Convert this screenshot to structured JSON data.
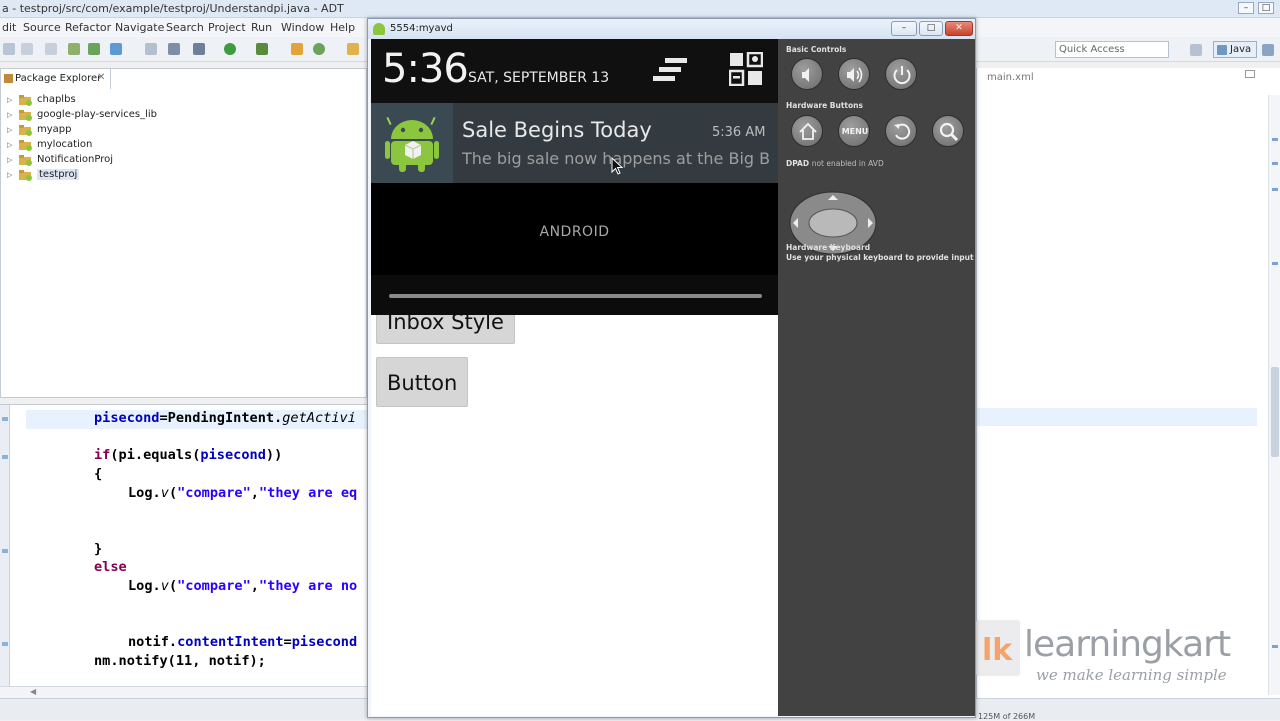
{
  "eclipse": {
    "window_title": "a - testproj/src/com/example/testproj/Understandpi.java - ADT",
    "menu": [
      "dit",
      "Source",
      "Refactor",
      "Navigate",
      "Search",
      "Project",
      "Run",
      "Window",
      "Help"
    ],
    "quick_access": "Quick Access",
    "perspective": "Java",
    "package_explorer": {
      "tab_label": "Package Explorer",
      "projects": [
        "chaplbs",
        "google-play-services_lib",
        "myapp",
        "mylocation",
        "NotificationProj",
        "testproj"
      ]
    },
    "right_tab": "main.xml",
    "heap_status": "125M of 266M"
  },
  "code": {
    "line1_field": "pisecond",
    "line1_rest": "=PendingIntent.",
    "line1_method": "getActivi",
    "line2_kw": "if",
    "line2_rest": "(pi.equals(",
    "line2_field": "pisecond",
    "line2_end": "))",
    "line3": "{",
    "line4_pre": "Log.",
    "line4_method": "v",
    "line4_str1": "\"compare\"",
    "line4_comma": ",",
    "line4_str2": "\"they are eq",
    "line5": "}",
    "line6": "else",
    "line7_pre": "Log.",
    "line7_method": "v",
    "line7_str1": "\"compare\"",
    "line7_comma": ",",
    "line7_str2": "\"they are no",
    "line8_pre": "notif.",
    "line8_field1": "contentIntent",
    "line8_eq": "=",
    "line8_field2": "pisecond",
    "line9": "nm.notify(11, notif);"
  },
  "emulator": {
    "window_title": "5554:myavd",
    "status": {
      "time": "5:36",
      "date": "SAT, SEPTEMBER 13"
    },
    "notification": {
      "title": "Sale Begins Today",
      "time": "5:36 AM",
      "text": "The big sale now happens at the Big B"
    },
    "carrier": "ANDROID",
    "app_buttons": [
      "Inbox Style",
      "Button"
    ],
    "controls": {
      "basic_controls": "Basic Controls",
      "hardware_buttons": "Hardware Buttons",
      "menu_label": "MENU",
      "dpad_label": "DPAD",
      "dpad_note": "not enabled in AVD",
      "keyboard_title": "Hardware Keyboard",
      "keyboard_note": "Use your physical keyboard to provide input"
    }
  },
  "watermark": {
    "brand": "learningkart",
    "tagline": "we make learning simple"
  },
  "colors": {
    "android_green": "#8cc63f",
    "notification_bg": "#333b40",
    "control_panel_bg": "#424242",
    "java_keyword": "#7f0055",
    "java_string": "#2a00ff",
    "java_field": "#0000c0"
  }
}
